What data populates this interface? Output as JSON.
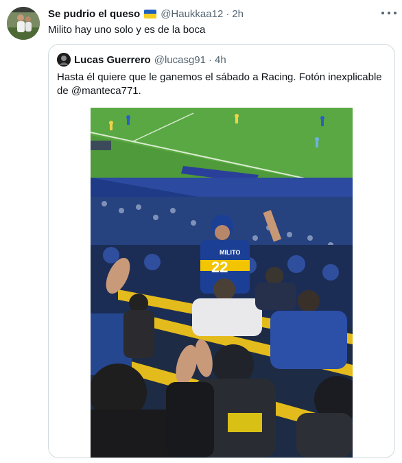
{
  "tweet": {
    "display_name": "Se pudrio el queso",
    "handle": "@Haukkaa12",
    "separator": "·",
    "time": "2h",
    "text": "Milito hay uno solo y es de la boca",
    "avatar_icon": "profile-photo-avatar",
    "flag_icon": "ukraine-flag-emoji",
    "more_icon": "more-options-icon"
  },
  "quote": {
    "display_name": "Lucas Guerrero",
    "handle": "@lucasg91",
    "separator": "·",
    "time": "4h",
    "text_line1": "Hasta él quiere que le ganemos el sábado a Racing. Fotón inexplicable",
    "text_line2_prefix": "de ",
    "mention": "@manteca771",
    "text_line2_suffix": ".",
    "photo": {
      "jersey_name": "MILITO",
      "jersey_number": "22"
    }
  },
  "colors": {
    "text_primary": "#0f1419",
    "text_secondary": "#536471",
    "border": "#cfd9de",
    "pitch_green": "#4f9a3a",
    "boca_blue": "#1b3f95",
    "boca_yellow": "#f2c500"
  }
}
